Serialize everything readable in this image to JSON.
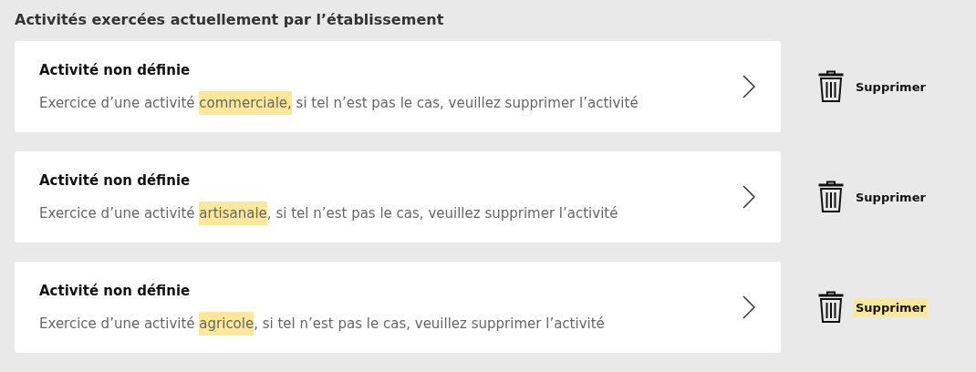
{
  "heading": "Activités exercées actuellement par l’établissement",
  "activities": [
    {
      "title": "Activité non définie",
      "description": {
        "before": "Exercice d’une activité ",
        "highlight": "commerciale,",
        "after": " si tel n’est pas le cas, veuillez supprimer l’activité"
      },
      "delete": {
        "label": "Supprimer",
        "highlighted": false
      }
    },
    {
      "title": "Activité non définie",
      "description": {
        "before": "Exercice d’une activité ",
        "highlight": "artisanale",
        "after": ", si tel n’est pas le cas, veuillez supprimer l’activité"
      },
      "delete": {
        "label": "Supprimer",
        "highlighted": false
      }
    },
    {
      "title": "Activité non définie",
      "description": {
        "before": "Exercice d’une activité ",
        "highlight": "agricole",
        "after": ", si tel n’est pas le cas, veuillez supprimer l’activité"
      },
      "delete": {
        "label": "Supprimer",
        "highlighted": true
      }
    }
  ]
}
